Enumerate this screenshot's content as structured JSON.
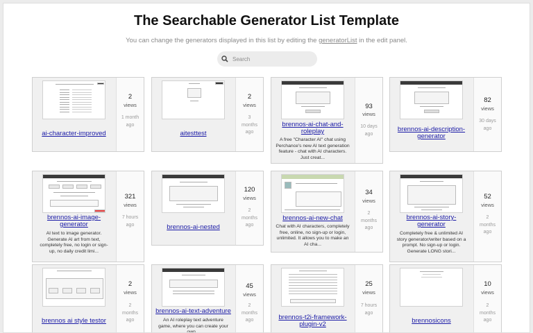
{
  "header": {
    "title": "The Searchable Generator List Template",
    "subtitle_before": "You can change the generators displayed in this list by editing the",
    "subtitle_link": "generatorList",
    "subtitle_after": "in the edit panel."
  },
  "search": {
    "placeholder": "Search",
    "icon": "search-icon"
  },
  "cards": [
    {
      "name": "ai-character-improved",
      "desc": "",
      "views": "2",
      "views_label": "views",
      "ago": "1 month ago"
    },
    {
      "name": "aitesttest",
      "desc": "",
      "views": "2",
      "views_label": "views",
      "ago": "3 months ago"
    },
    {
      "name": "brennos-ai-chat-and-roleplay",
      "desc": "A free \"Character AI\" chat using Perchance's new AI text generation feature - chat with AI characters. Just creat...",
      "views": "93",
      "views_label": "views",
      "ago": "10 days ago"
    },
    {
      "name": "brennos-ai-description-generator",
      "desc": "",
      "views": "82",
      "views_label": "views",
      "ago": "30 days ago"
    },
    {
      "name": "brennos-ai-image-generator",
      "desc": "AI text to image generator. Generate AI art from text, completely free, no login or sign-up, no daily credit limi...",
      "views": "321",
      "views_label": "views",
      "ago": "7 hours ago"
    },
    {
      "name": "brennos-ai-nested",
      "desc": "",
      "views": "120",
      "views_label": "views",
      "ago": "2 months ago"
    },
    {
      "name": "brennos-ai-new-chat",
      "desc": "Chat with AI characters, completely free, online, no sign-up or login, unlimited. It allows you to make an AI cha...",
      "views": "34",
      "views_label": "views",
      "ago": "2 months ago"
    },
    {
      "name": "brennos-ai-story-generator",
      "desc": "Completely free & unlimited AI story generator/writer based on a prompt. No sign-up or login. Generate LONG stori...",
      "views": "52",
      "views_label": "views",
      "ago": "2 months ago"
    },
    {
      "name": "brennos ai style testor",
      "desc": "",
      "views": "2",
      "views_label": "views",
      "ago": "2 months ago"
    },
    {
      "name": "brennos-ai-text-adventure",
      "desc": "An AI roleplay text adventure game, where you can create your own...",
      "views": "45",
      "views_label": "views",
      "ago": "2 months ago"
    },
    {
      "name": "brennos-t2i-framework-plugin-v2",
      "desc": "",
      "views": "25",
      "views_label": "views",
      "ago": "7 hours ago"
    },
    {
      "name": "brennosicons",
      "desc": "",
      "views": "10",
      "views_label": "views",
      "ago": "2 months ago"
    }
  ],
  "colors": {
    "link": "#1a1aa6",
    "card_bg": "#f0f0f0",
    "page_bg": "#ffffff"
  }
}
